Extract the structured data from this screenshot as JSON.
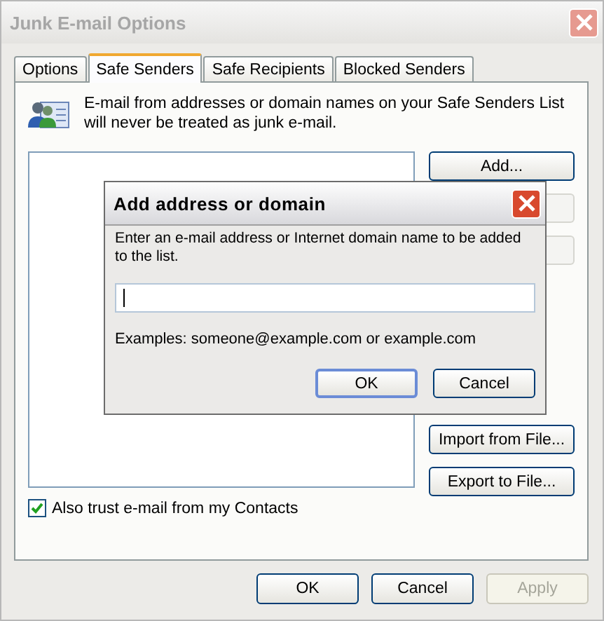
{
  "window": {
    "title": "Junk E-mail Options",
    "active": false
  },
  "tabs": [
    {
      "label": "Options",
      "selected": false
    },
    {
      "label": "Safe Senders",
      "selected": true
    },
    {
      "label": "Safe Recipients",
      "selected": false
    },
    {
      "label": "Blocked Senders",
      "selected": false
    }
  ],
  "description": "E-mail from addresses or domain names on your Safe Senders List will never be treated as junk e-mail.",
  "side_buttons": [
    {
      "label": "Add...",
      "covered": false
    },
    {
      "covered": true
    },
    {
      "covered": true
    },
    {
      "label": "Import from File...",
      "covered": false
    },
    {
      "label": "Export to File...",
      "covered": false
    }
  ],
  "trust_contacts": {
    "label": "Also trust e-mail from my Contacts",
    "checked": true
  },
  "buttons": [
    {
      "label": "OK",
      "disabled": false
    },
    {
      "label": "Cancel",
      "disabled": false
    },
    {
      "label": "Apply",
      "disabled": true
    }
  ],
  "dialog": {
    "title": "Add address or domain",
    "prompt": "Enter an e-mail address or Internet domain name to be added to the list.",
    "input": {
      "focused": true
    },
    "examples": "Examples: someone@example.com or example.com",
    "buttons": [
      {
        "label": "OK",
        "default": true
      },
      {
        "label": "Cancel",
        "default": false
      }
    ]
  }
}
